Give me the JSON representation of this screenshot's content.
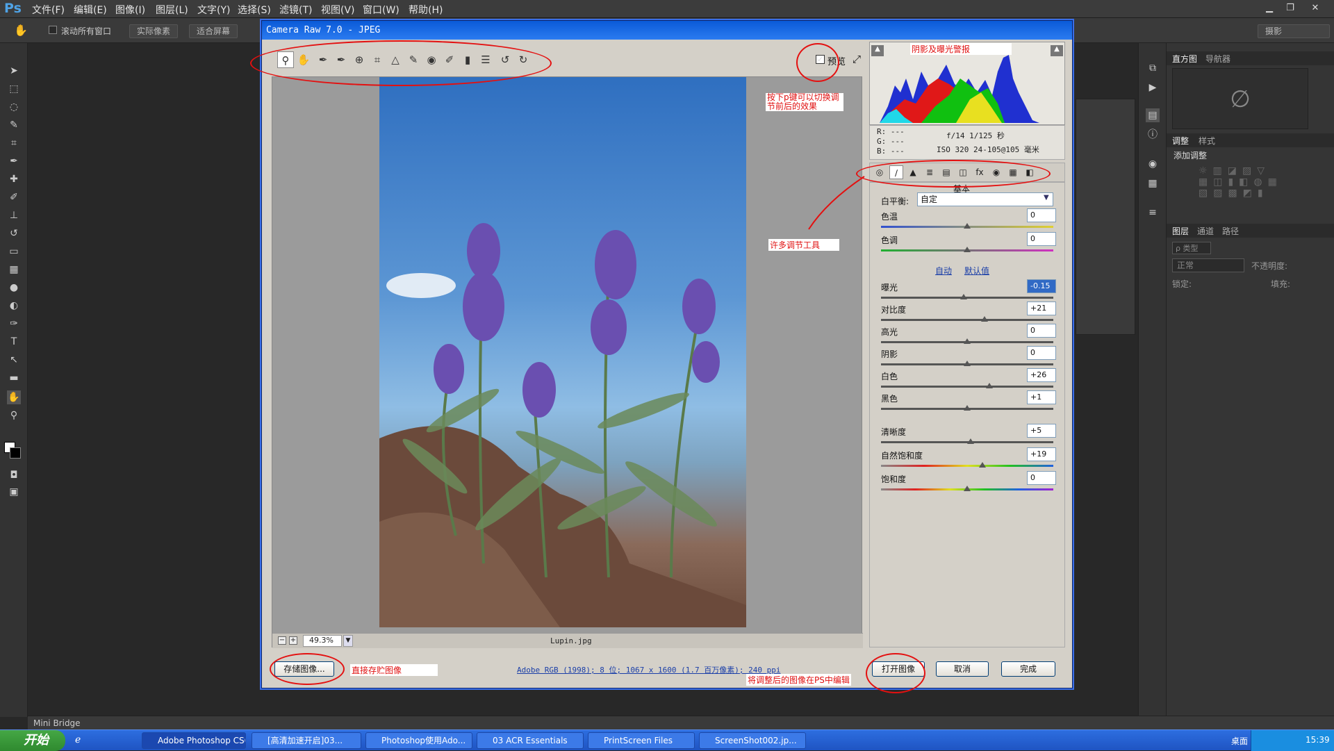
{
  "menubar": {
    "logo": "Ps",
    "items": [
      "文件(F)",
      "编辑(E)",
      "图像(I)",
      "图层(L)",
      "文字(Y)",
      "选择(S)",
      "滤镜(T)",
      "视图(V)",
      "窗口(W)",
      "帮助(H)"
    ]
  },
  "optbar": {
    "scroll_all": "滚动所有窗口",
    "actual_pixels": "实际像素",
    "fit_screen": "适合屏幕",
    "workspace": "摄影"
  },
  "right_panel": {
    "tab_histogram": "直方图",
    "tab_navigator": "导航器",
    "tab_adjust": "调整",
    "tab_styles": "样式",
    "add_adjust": "添加调整",
    "tab_layers": "图层",
    "tab_channels": "通道",
    "tab_paths": "路径",
    "layer_kind": "ρ 类型",
    "blend_mode": "正常",
    "opacity_label": "不透明度:",
    "lock_label": "锁定:",
    "fill_label": "填充:"
  },
  "minibridge": {
    "label": "Mini Bridge"
  },
  "taskbar": {
    "start": "开始",
    "items": [
      "Adobe Photoshop CS6",
      "[高清加速开启]03...",
      "Photoshop使用Ado...",
      "03 ACR Essentials",
      "PrintScreen Files",
      "ScreenShot002.jp..."
    ],
    "tray_desktop": "桌面",
    "time": "15:39"
  },
  "acr": {
    "title": "Camera Raw 7.0 -  JPEG",
    "preview_label": "预览",
    "zoom": "49.3%",
    "filename": "Lupin.jpg",
    "info_link": "Adobe RGB (1998); 8 位; 1067 x 1600 (1.7 百万像素); 240 ppi",
    "rgb": {
      "r": "R:  ---",
      "g": "G:  ---",
      "b": "B:  ---"
    },
    "exif_line1": "f/14   1/125 秒",
    "exif_line2": "ISO 320   24-105@105 毫米",
    "panel_title": "基本",
    "wb_label": "白平衡:",
    "wb_value": "自定",
    "auto": "自动",
    "default": "默认值",
    "sliders": [
      {
        "label": "色温",
        "value": "0",
        "pos": 0.5
      },
      {
        "label": "色调",
        "value": "0",
        "pos": 0.5
      },
      {
        "label": "曝光",
        "value": "-0.15",
        "pos": 0.48
      },
      {
        "label": "对比度",
        "value": "+21",
        "pos": 0.6
      },
      {
        "label": "高光",
        "value": "0",
        "pos": 0.5
      },
      {
        "label": "阴影",
        "value": "0",
        "pos": 0.5
      },
      {
        "label": "白色",
        "value": "+26",
        "pos": 0.63
      },
      {
        "label": "黑色",
        "value": "+1",
        "pos": 0.5
      },
      {
        "label": "清晰度",
        "value": "+5",
        "pos": 0.52
      },
      {
        "label": "自然饱和度",
        "value": "+19",
        "pos": 0.59
      },
      {
        "label": "饱和度",
        "value": "0",
        "pos": 0.5
      }
    ],
    "save_btn": "存储图像...",
    "open_btn": "打开图像",
    "cancel_btn": "取消",
    "done_btn": "完成"
  },
  "annotations": {
    "shadow_warning": "阴影及曝光警报",
    "press_p": "按下p键可以切换调节前后的效果",
    "many_tools": "许多调节工具",
    "save_direct": "直接存贮图像",
    "open_in_ps": "将调整后的图像在PS中编辑"
  },
  "colors": {
    "accent": "#0a5ad8",
    "annotation": "#e41010",
    "ps_bg": "#282828"
  }
}
